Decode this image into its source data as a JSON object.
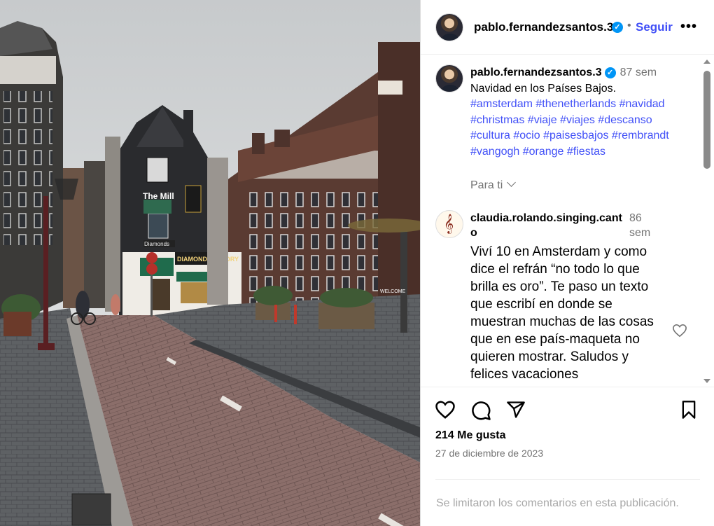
{
  "post": {
    "author": "pablo.fernandezsantos.3",
    "verified_icon": "verified-badge-icon",
    "follow_label": "Seguir",
    "more_icon": "more-options-icon"
  },
  "caption": {
    "author": "pablo.fernandezsantos.3",
    "time": "87 sem",
    "text": "Navidad en los Países Bajos.",
    "hashtags": "#amsterdam #thenetherlands #navidad #christmas #viaje #viajes #descanso #cultura #ocio #paisesbajos #rembrandt #vangogh #orange #fiestas",
    "para_ti": "Para ti"
  },
  "comment": {
    "user": "claudia.rolando.singing.canto",
    "time": "86 sem",
    "text": "Viví 10 en Amsterdam y como dice el refrán “no todo lo que brilla es oro”. Te paso un texto que escribí en donde se muestran muchas de las cosas que en ese país-maqueta no quieren mostrar. Saludos y felices vacaciones"
  },
  "actions": {
    "likes": "214 Me gusta",
    "date": "27 de diciembre de 2023",
    "comments_limited": "Se limitaron los comentarios en esta publicación."
  },
  "photo": {
    "signs": {
      "the_mill": "The Mill",
      "diamond_factory": "DIAMOND FACTORY",
      "diamonds": "Diamonds",
      "welcome": "WELCOME"
    }
  }
}
